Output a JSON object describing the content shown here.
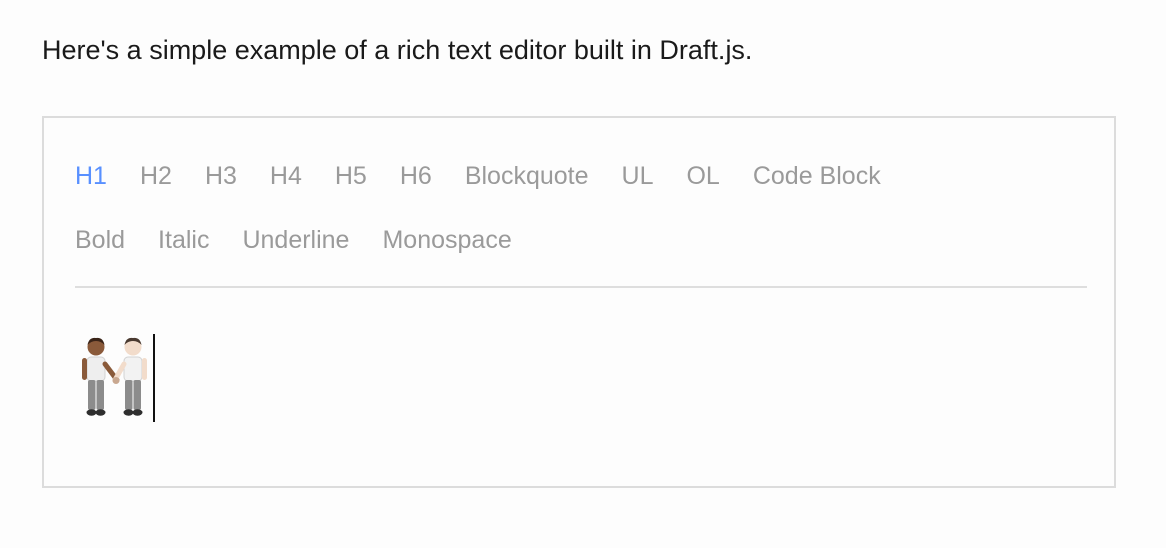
{
  "intro_text": "Here's a simple example of a rich text editor built in Draft.js.",
  "toolbar": {
    "block_styles": [
      "H1",
      "H2",
      "H3",
      "H4",
      "H5",
      "H6",
      "Blockquote",
      "UL",
      "OL",
      "Code Block"
    ],
    "inline_styles": [
      "Bold",
      "Italic",
      "Underline",
      "Monospace"
    ],
    "active_style": "H1"
  },
  "editor": {
    "content_icon": "people-holding-hands-emoji-icon"
  },
  "colors": {
    "active": "#5890ff",
    "inactive": "#9a9a9a",
    "border": "#dcdcdc",
    "text": "#1a1a1a"
  }
}
